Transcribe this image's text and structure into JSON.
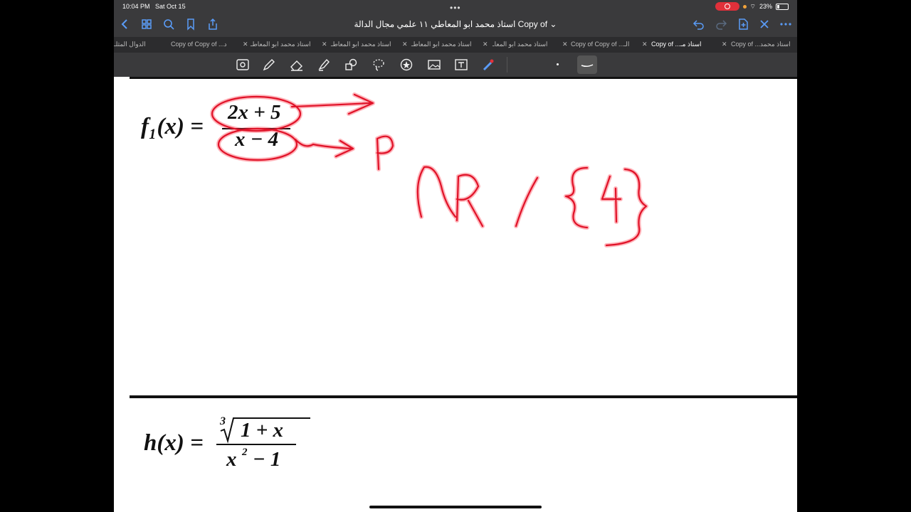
{
  "status": {
    "time": "10:04 PM",
    "date": "Sat Oct 15",
    "battery": "23%"
  },
  "nav": {
    "title": "استاذ محمد ابو المعاطي ١١ علمي مجال الدالة Copy of",
    "icons": [
      "back-icon",
      "grid-icon",
      "search-icon",
      "bookmark-icon",
      "share-icon",
      "undo-icon",
      "redo-icon",
      "add-page-icon",
      "close-icon",
      "more-icon"
    ]
  },
  "tabs": [
    {
      "label": "الدوال المثلـ"
    },
    {
      "label": "Copy of Copy of ...د"
    },
    {
      "label": "استاذ محمد ابو المعاطـ"
    },
    {
      "label": "استاذ محمد ابو المعاطـ"
    },
    {
      "label": "استاذ محمد ابو المعاطـ"
    },
    {
      "label": "استاذ محمد ابو المعاـ"
    },
    {
      "label": "Copy of Copy of ...الـ"
    },
    {
      "label": "Copy of ...استاذ مـ",
      "active": true
    },
    {
      "label": "Copy of ...استاذ محمد"
    }
  ],
  "toolbar": {
    "tools": [
      "scan-icon",
      "pen-icon",
      "eraser-icon",
      "highlighter-icon",
      "shapes-icon",
      "lasso-icon",
      "sticker-icon",
      "image-icon",
      "text-icon",
      "laser-icon"
    ]
  },
  "equation1": {
    "lhs": "f₁(x) =",
    "numerator": "2x + 5",
    "denominator": "x − 4"
  },
  "equation2": {
    "lhs": "h(x) =",
    "root_index": "3",
    "numerator": "1 + x",
    "denominator_base": "x",
    "denominator_exp": "2",
    "denominator_rest": "− 1"
  },
  "annotations": {
    "color": "#e01228",
    "p_label": "P",
    "domain": "ℝ / {4}"
  }
}
